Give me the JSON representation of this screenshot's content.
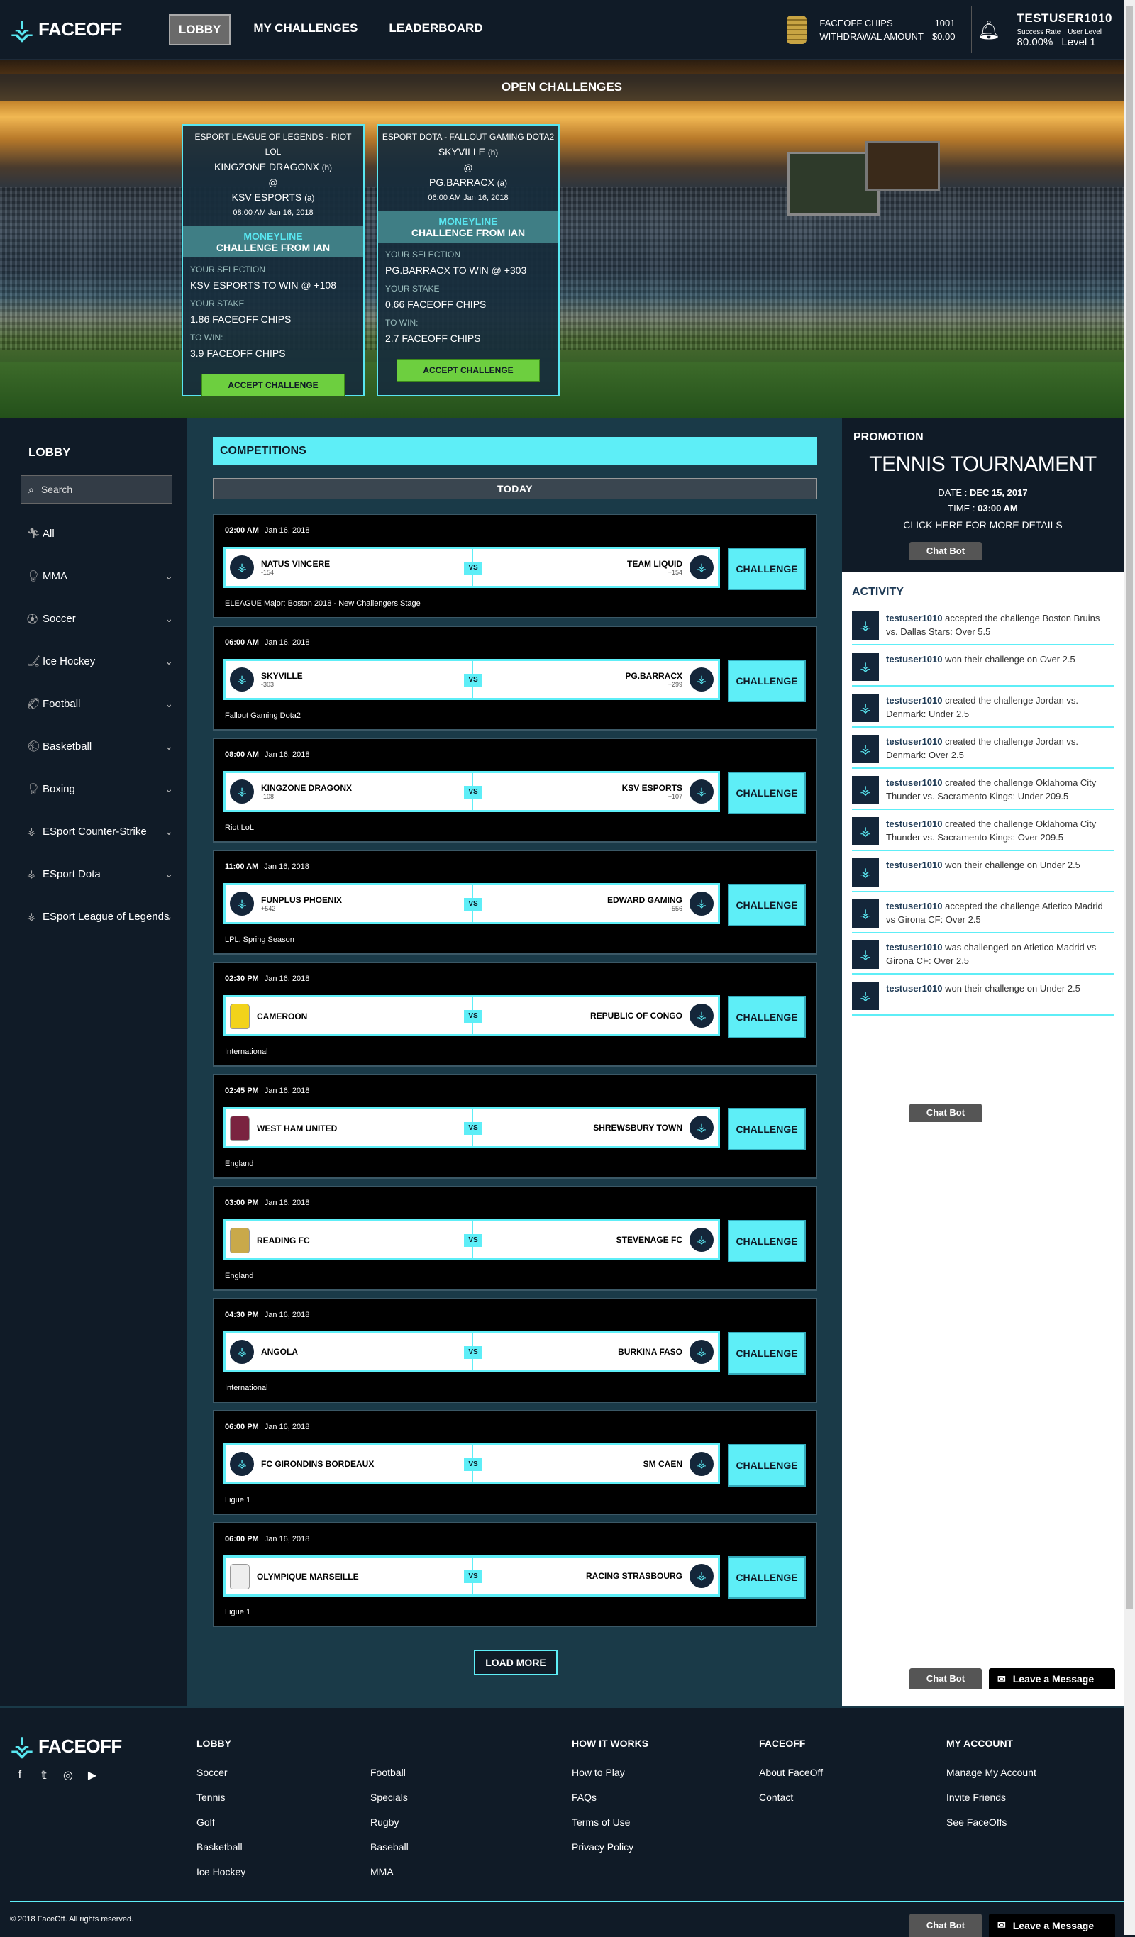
{
  "brand": {
    "name": "FACEOFF"
  },
  "nav": [
    {
      "label": "LOBBY",
      "active": true
    },
    {
      "label": "MY CHALLENGES",
      "active": false
    },
    {
      "label": "LEADERBOARD",
      "active": false
    }
  ],
  "account": {
    "chips_label": "FACEOFF CHIPS",
    "chips_value": "1001",
    "withdrawal_label": "WITHDRAWAL AMOUNT",
    "withdrawal_value": "$0.00",
    "username": "TESTUSER1010",
    "success_label": "Success Rate",
    "success_value": "80.00%",
    "level_label": "User Level",
    "level_value": "Level 1"
  },
  "open_challenges": {
    "title": "OPEN CHALLENGES",
    "cards": [
      {
        "league": "ESPORT LEAGUE OF LEGENDS - RIOT LOL",
        "home": "KINGZONE DRAGONX",
        "home_tag": "(h)",
        "at": "@",
        "away": "KSV ESPORTS",
        "away_tag": "(a)",
        "datetime": "08:00 AM Jan 16, 2018",
        "market": "MONEYLINE",
        "from": "CHALLENGE FROM IAN",
        "sel_label": "YOUR SELECTION",
        "selection": "KSV ESPORTS TO WIN @ +108",
        "stake_label": "YOUR STAKE",
        "stake": "1.86 FACEOFF CHIPS",
        "win_label": "TO WIN:",
        "win": "3.9 FACEOFF CHIPS",
        "button": "ACCEPT CHALLENGE"
      },
      {
        "league": "ESPORT DOTA - FALLOUT GAMING DOTA2",
        "home": "SKYVILLE",
        "home_tag": "(h)",
        "at": "@",
        "away": "PG.BARRACX",
        "away_tag": "(a)",
        "datetime": "06:00 AM Jan 16, 2018",
        "market": "MONEYLINE",
        "from": "CHALLENGE FROM IAN",
        "sel_label": "YOUR SELECTION",
        "selection": "PG.BARRACX TO WIN @ +303",
        "stake_label": "YOUR STAKE",
        "stake": "0.66 FACEOFF CHIPS",
        "win_label": "TO WIN:",
        "win": "2.7 FACEOFF CHIPS",
        "button": "ACCEPT CHALLENGE"
      }
    ]
  },
  "sidebar": {
    "title": "LOBBY",
    "search_placeholder": "Search",
    "items": [
      {
        "label": "All",
        "icon": "runner-icon",
        "expandable": false
      },
      {
        "label": "MMA",
        "icon": "mma-icon",
        "expandable": true
      },
      {
        "label": "Soccer",
        "icon": "soccer-icon",
        "expandable": true
      },
      {
        "label": "Ice Hockey",
        "icon": "hockey-icon",
        "expandable": true
      },
      {
        "label": "Football",
        "icon": "football-icon",
        "expandable": true
      },
      {
        "label": "Basketball",
        "icon": "basketball-icon",
        "expandable": true
      },
      {
        "label": "Boxing",
        "icon": "boxing-icon",
        "expandable": true
      },
      {
        "label": "ESport Counter-Strike",
        "icon": "esport-icon",
        "expandable": true
      },
      {
        "label": "ESport Dota",
        "icon": "esport-icon",
        "expandable": true
      },
      {
        "label": "ESport League of Legends",
        "icon": "esport-icon",
        "expandable": true
      }
    ]
  },
  "competitions": {
    "title": "COMPETITIONS",
    "day": "TODAY",
    "challenge_label": "CHALLENGE",
    "vs_label": "VS",
    "load_more": "LOAD MORE",
    "games": [
      {
        "time": "02:00 AM",
        "date": "Jan 16, 2018",
        "home": "NATUS VINCERE",
        "home_odds": "-154",
        "away": "TEAM LIQUID",
        "away_odds": "+154",
        "league": "ELEAGUE Major: Boston 2018 - New Challengers Stage",
        "home_badge": "crest"
      },
      {
        "time": "06:00 AM",
        "date": "Jan 16, 2018",
        "home": "SKYVILLE",
        "home_odds": "-303",
        "away": "PG.BARRACX",
        "away_odds": "+299",
        "league": "Fallout Gaming Dota2",
        "home_badge": "crest"
      },
      {
        "time": "08:00 AM",
        "date": "Jan 16, 2018",
        "home": "KINGZONE DRAGONX",
        "home_odds": "-108",
        "away": "KSV ESPORTS",
        "away_odds": "+107",
        "league": "Riot LoL",
        "home_badge": "crest"
      },
      {
        "time": "11:00 AM",
        "date": "Jan 16, 2018",
        "home": "FUNPLUS PHOENIX",
        "home_odds": "+542",
        "away": "EDWARD GAMING",
        "away_odds": "-556",
        "league": "LPL, Spring Season",
        "home_badge": "crest"
      },
      {
        "time": "02:30 PM",
        "date": "Jan 16, 2018",
        "home": "CAMEROON",
        "home_odds": "",
        "away": "REPUBLIC OF CONGO",
        "away_odds": "",
        "league": "International",
        "home_badge": "shirt-yellow"
      },
      {
        "time": "02:45 PM",
        "date": "Jan 16, 2018",
        "home": "WEST HAM UNITED",
        "home_odds": "",
        "away": "SHREWSBURY TOWN",
        "away_odds": "",
        "league": "England",
        "home_badge": "shirt-claret"
      },
      {
        "time": "03:00 PM",
        "date": "Jan 16, 2018",
        "home": "READING FC",
        "home_odds": "",
        "away": "STEVENAGE FC",
        "away_odds": "",
        "league": "England",
        "home_badge": "shirt-gold"
      },
      {
        "time": "04:30 PM",
        "date": "Jan 16, 2018",
        "home": "ANGOLA",
        "home_odds": "",
        "away": "BURKINA FASO",
        "away_odds": "",
        "league": "International",
        "home_badge": "crest"
      },
      {
        "time": "06:00 PM",
        "date": "Jan 16, 2018",
        "home": "FC GIRONDINS BORDEAUX",
        "home_odds": "",
        "away": "SM CAEN",
        "away_odds": "",
        "league": "Ligue 1",
        "home_badge": "crest"
      },
      {
        "time": "06:00 PM",
        "date": "Jan 16, 2018",
        "home": "OLYMPIQUE MARSEILLE",
        "home_odds": "",
        "away": "RACING STRASBOURG",
        "away_odds": "",
        "league": "Ligue 1",
        "home_badge": "shirt-white"
      }
    ]
  },
  "promotion": {
    "title": "PROMOTION",
    "event": "TENNIS TOURNAMENT",
    "date_label": "DATE :",
    "date_value": "DEC 15, 2017",
    "time_label": "TIME :",
    "time_value": "03:00 AM",
    "more": "CLICK HERE FOR MORE DETAILS"
  },
  "activity": {
    "title": "ACTIVITY",
    "items": [
      {
        "user": "testuser1010",
        "text": "accepted the challenge Boston Bruins vs. Dallas Stars: Over 5.5"
      },
      {
        "user": "testuser1010",
        "text": "won their challenge on Over 2.5"
      },
      {
        "user": "testuser1010",
        "text": "created the challenge Jordan vs. Denmark: Under 2.5"
      },
      {
        "user": "testuser1010",
        "text": "created the challenge Jordan vs. Denmark: Over 2.5"
      },
      {
        "user": "testuser1010",
        "text": "created the challenge Oklahoma City Thunder vs. Sacramento Kings: Under 209.5"
      },
      {
        "user": "testuser1010",
        "text": "created the challenge Oklahoma City Thunder vs. Sacramento Kings: Over 209.5"
      },
      {
        "user": "testuser1010",
        "text": "won their challenge on Under 2.5"
      },
      {
        "user": "testuser1010",
        "text": "accepted the challenge Atletico Madrid vs Girona CF: Over 2.5"
      },
      {
        "user": "testuser1010",
        "text": "was challenged on Atletico Madrid vs Girona CF: Over 2.5"
      },
      {
        "user": "testuser1010",
        "text": "won their challenge on Under 2.5"
      }
    ]
  },
  "widgets": {
    "chat_bot": "Chat Bot",
    "leave_message": "Leave a Message"
  },
  "footer": {
    "columns": [
      {
        "title": "LOBBY",
        "links": [
          "Soccer",
          "Tennis",
          "Golf",
          "Basketball",
          "Ice Hockey"
        ]
      },
      {
        "title": "",
        "links": [
          "Football",
          "Specials",
          "Rugby",
          "Baseball",
          "MMA"
        ]
      },
      {
        "title": "HOW IT WORKS",
        "links": [
          "How to Play",
          "FAQs",
          "Terms of Use",
          "Privacy Policy"
        ]
      },
      {
        "title": "FACEOFF",
        "links": [
          "About FaceOff",
          "Contact"
        ]
      },
      {
        "title": "MY ACCOUNT",
        "links": [
          "Manage My Account",
          "Invite Friends",
          "See FaceOffs"
        ]
      }
    ],
    "copyright": "© 2018 FaceOff. All rights reserved."
  },
  "colors": {
    "accent": "#5eeef7",
    "background": "#101b27",
    "accept": "#6dcf3f"
  }
}
